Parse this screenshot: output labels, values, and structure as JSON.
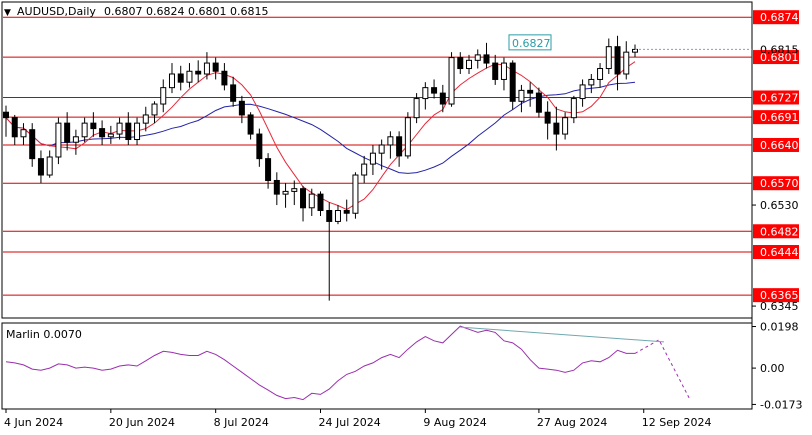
{
  "header": {
    "dropdown_glyph": "▼",
    "symbol": "AUDUSD,Daily",
    "ohlc": [
      "0.6807",
      "0.6824",
      "0.6801",
      "0.6815"
    ]
  },
  "price_axis": {
    "min": 0.6325,
    "max": 0.69,
    "ticks": [
      "0.6530",
      "0.6345"
    ],
    "current_price": 0.6815,
    "current_label": "0.6815",
    "bubble_color": "#ff0000"
  },
  "levels": [
    {
      "value": 0.6874,
      "label": "0.6874"
    },
    {
      "value": 0.6801,
      "label": "0.6801"
    },
    {
      "value": 0.6727,
      "label": "0.6727"
    },
    {
      "value": 0.6691,
      "label": "0.6691"
    },
    {
      "value": 0.664,
      "label": "0.6640"
    },
    {
      "value": 0.657,
      "label": "0.6570"
    },
    {
      "value": 0.6482,
      "label": "0.6482"
    },
    {
      "value": 0.6444,
      "label": "0.6444"
    },
    {
      "value": 0.6365,
      "label": "0.6365"
    }
  ],
  "callout": {
    "value": 0.6827,
    "label": "0.6827",
    "color": "#2a9da8"
  },
  "candles": [
    [
      0.67,
      0.6712,
      0.6655,
      0.669
    ],
    [
      0.669,
      0.6695,
      0.664,
      0.6655
    ],
    [
      0.6655,
      0.668,
      0.664,
      0.6668
    ],
    [
      0.6668,
      0.668,
      0.66,
      0.6615
    ],
    [
      0.6615,
      0.663,
      0.657,
      0.6585
    ],
    [
      0.6585,
      0.663,
      0.658,
      0.6618
    ],
    [
      0.6618,
      0.669,
      0.6605,
      0.668
    ],
    [
      0.668,
      0.67,
      0.663,
      0.6645
    ],
    [
      0.6645,
      0.6668,
      0.6622,
      0.6655
    ],
    [
      0.6655,
      0.669,
      0.6645,
      0.668
    ],
    [
      0.668,
      0.67,
      0.6655,
      0.667
    ],
    [
      0.667,
      0.6685,
      0.664,
      0.6655
    ],
    [
      0.6655,
      0.6675,
      0.6642,
      0.666
    ],
    [
      0.666,
      0.669,
      0.665,
      0.668
    ],
    [
      0.668,
      0.67,
      0.664,
      0.665
    ],
    [
      0.665,
      0.669,
      0.664,
      0.668
    ],
    [
      0.668,
      0.671,
      0.6665,
      0.6695
    ],
    [
      0.6695,
      0.672,
      0.668,
      0.6715
    ],
    [
      0.6715,
      0.676,
      0.67,
      0.6745
    ],
    [
      0.6745,
      0.679,
      0.6735,
      0.677
    ],
    [
      0.677,
      0.6785,
      0.674,
      0.6755
    ],
    [
      0.6755,
      0.679,
      0.6745,
      0.6775
    ],
    [
      0.6775,
      0.6795,
      0.6755,
      0.677
    ],
    [
      0.677,
      0.681,
      0.676,
      0.679
    ],
    [
      0.679,
      0.68,
      0.676,
      0.6775
    ],
    [
      0.6775,
      0.679,
      0.674,
      0.675
    ],
    [
      0.675,
      0.6765,
      0.671,
      0.672
    ],
    [
      0.672,
      0.673,
      0.668,
      0.6695
    ],
    [
      0.6695,
      0.67,
      0.665,
      0.666
    ],
    [
      0.666,
      0.667,
      0.66,
      0.6615
    ],
    [
      0.6615,
      0.6625,
      0.656,
      0.6575
    ],
    [
      0.6575,
      0.659,
      0.653,
      0.655
    ],
    [
      0.655,
      0.657,
      0.6525,
      0.6555
    ],
    [
      0.6555,
      0.6575,
      0.653,
      0.656
    ],
    [
      0.656,
      0.6565,
      0.65,
      0.6525
    ],
    [
      0.6525,
      0.656,
      0.651,
      0.655
    ],
    [
      0.655,
      0.6555,
      0.651,
      0.652
    ],
    [
      0.652,
      0.6535,
      0.6355,
      0.65
    ],
    [
      0.65,
      0.653,
      0.6495,
      0.652
    ],
    [
      0.652,
      0.654,
      0.65,
      0.6515
    ],
    [
      0.6515,
      0.659,
      0.6505,
      0.6585
    ],
    [
      0.6585,
      0.662,
      0.657,
      0.6605
    ],
    [
      0.6605,
      0.664,
      0.6585,
      0.6625
    ],
    [
      0.6625,
      0.665,
      0.6595,
      0.664
    ],
    [
      0.664,
      0.6665,
      0.6615,
      0.6655
    ],
    [
      0.6655,
      0.6665,
      0.66,
      0.662
    ],
    [
      0.662,
      0.67,
      0.6615,
      0.669
    ],
    [
      0.669,
      0.6735,
      0.668,
      0.6725
    ],
    [
      0.6725,
      0.6755,
      0.6705,
      0.6745
    ],
    [
      0.6745,
      0.676,
      0.6725,
      0.6735
    ],
    [
      0.6735,
      0.675,
      0.67,
      0.6715
    ],
    [
      0.6715,
      0.681,
      0.671,
      0.68
    ],
    [
      0.68,
      0.681,
      0.677,
      0.678
    ],
    [
      0.678,
      0.6805,
      0.677,
      0.6795
    ],
    [
      0.6795,
      0.6815,
      0.678,
      0.6805
    ],
    [
      0.6805,
      0.6827,
      0.678,
      0.679
    ],
    [
      0.679,
      0.6805,
      0.675,
      0.676
    ],
    [
      0.676,
      0.68,
      0.674,
      0.679
    ],
    [
      0.679,
      0.6795,
      0.6705,
      0.672
    ],
    [
      0.672,
      0.675,
      0.67,
      0.674
    ],
    [
      0.674,
      0.6755,
      0.671,
      0.6735
    ],
    [
      0.6735,
      0.6745,
      0.669,
      0.67
    ],
    [
      0.67,
      0.672,
      0.665,
      0.668
    ],
    [
      0.668,
      0.671,
      0.663,
      0.666
    ],
    [
      0.666,
      0.67,
      0.665,
      0.669
    ],
    [
      0.669,
      0.673,
      0.668,
      0.6725
    ],
    [
      0.6725,
      0.676,
      0.671,
      0.675
    ],
    [
      0.675,
      0.677,
      0.6735,
      0.676
    ],
    [
      0.676,
      0.679,
      0.6745,
      0.678
    ],
    [
      0.678,
      0.6835,
      0.677,
      0.682
    ],
    [
      0.682,
      0.684,
      0.674,
      0.677
    ],
    [
      0.677,
      0.683,
      0.676,
      0.681
    ],
    [
      0.681,
      0.6824,
      0.6801,
      0.6815
    ]
  ],
  "x_axis": {
    "labels": [
      {
        "text": "4 Jun 2024",
        "bar": 0
      },
      {
        "text": "20 Jun 2024",
        "bar": 12
      },
      {
        "text": "8 Jul 2024",
        "bar": 24
      },
      {
        "text": "24 Jul 2024",
        "bar": 36
      },
      {
        "text": "9 Aug 2024",
        "bar": 48
      },
      {
        "text": "27 Aug 2024",
        "bar": 61
      },
      {
        "text": "12 Sep 2024",
        "bar": 73
      }
    ]
  },
  "indicator": {
    "label": "Marlin 0.0070",
    "min": -0.019,
    "max": 0.021,
    "ticks": [
      "0.0198",
      "0.00",
      "-0.0173"
    ],
    "values": [
      0.003,
      0.0025,
      0.0015,
      -0.0005,
      -0.001,
      0.0,
      0.002,
      0.0015,
      0.0,
      0.0005,
      0.0,
      -0.001,
      -0.0005,
      0.001,
      0.0015,
      0.001,
      0.0035,
      0.006,
      0.008,
      0.0075,
      0.0065,
      0.006,
      0.006,
      0.008,
      0.0065,
      0.004,
      0.001,
      -0.002,
      -0.005,
      -0.008,
      -0.0105,
      -0.013,
      -0.0145,
      -0.014,
      -0.015,
      -0.012,
      -0.0125,
      -0.01,
      -0.006,
      -0.003,
      -0.0015,
      0.001,
      0.0025,
      0.005,
      0.0065,
      0.005,
      0.009,
      0.0125,
      0.015,
      0.013,
      0.012,
      0.016,
      0.02,
      0.0185,
      0.017,
      0.018,
      0.017,
      0.013,
      0.012,
      0.009,
      0.004,
      0.0,
      -0.0005,
      -0.001,
      -0.002,
      -0.001,
      0.0025,
      0.0035,
      0.003,
      0.005,
      0.0085,
      0.007,
      0.007
    ],
    "forecast": [
      0.0135,
      -0.015
    ],
    "trendline": [
      0.0195,
      0.0125
    ],
    "line_color": "#9b2fae",
    "trendline_color": "#6fa8ad"
  },
  "colors": {
    "level": "#d40000",
    "ma_fast": "#e8283a",
    "ma_slow": "#2424a8",
    "candle": "#000000"
  }
}
